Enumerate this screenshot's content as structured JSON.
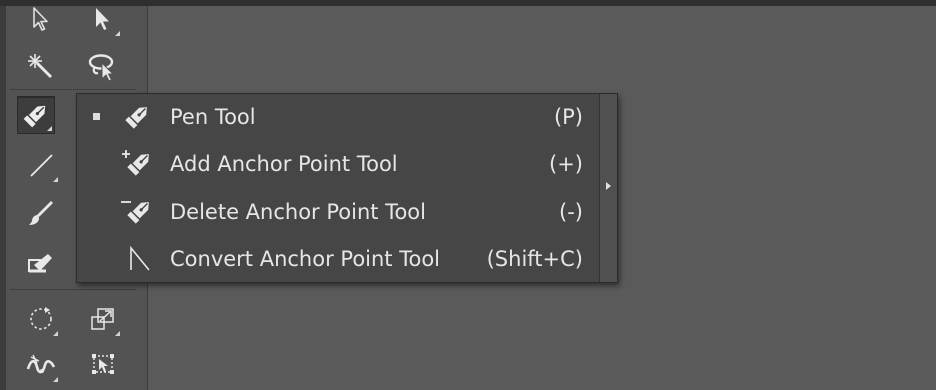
{
  "toolbar": {
    "tools": [
      {
        "name": "selection-tool",
        "icon": "selection-arrow-icon"
      },
      {
        "name": "direct-selection-tool",
        "icon": "direct-selection-arrow-icon"
      },
      {
        "name": "magic-wand-tool",
        "icon": "magic-wand-icon"
      },
      {
        "name": "lasso-tool",
        "icon": "lasso-icon"
      },
      {
        "name": "pen-tool",
        "icon": "pen-icon",
        "active": true
      },
      {
        "name": "line-segment-tool",
        "icon": "line-icon"
      },
      {
        "name": "paintbrush-tool",
        "icon": "paintbrush-icon"
      },
      {
        "name": "shaper-tool",
        "icon": "shaper-icon"
      },
      {
        "name": "rotate-tool",
        "icon": "rotate-icon"
      },
      {
        "name": "scale-tool",
        "icon": "scale-icon"
      },
      {
        "name": "width-tool",
        "icon": "width-icon"
      },
      {
        "name": "free-transform-tool",
        "icon": "free-transform-icon"
      }
    ]
  },
  "flyout": {
    "items": [
      {
        "label": "Pen Tool",
        "shortcut": "(P)",
        "icon": "pen-icon",
        "selected": true
      },
      {
        "label": "Add Anchor Point Tool",
        "shortcut": "(+)",
        "icon": "add-anchor-point-icon",
        "selected": false
      },
      {
        "label": "Delete Anchor Point Tool",
        "shortcut": "(-)",
        "icon": "delete-anchor-point-icon",
        "selected": false
      },
      {
        "label": "Convert Anchor Point Tool",
        "shortcut": "(Shift+C)",
        "icon": "convert-anchor-point-icon",
        "selected": false
      }
    ]
  },
  "colors": {
    "canvas": "#5a5a5a",
    "toolbar": "#535353",
    "flyout": "#464646",
    "text": "#e6e6e6"
  }
}
